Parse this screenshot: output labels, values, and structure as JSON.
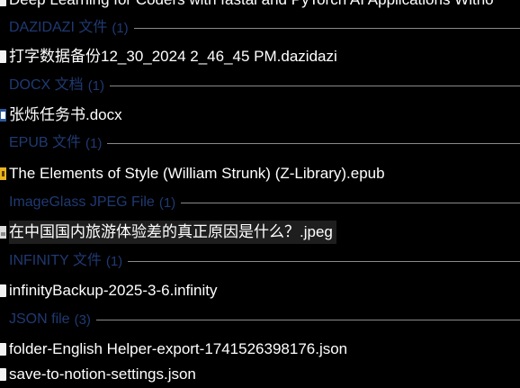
{
  "top_truncated_item": {
    "name": "Deep Learning for Coders with fastai and PyTorch AI Applications Witho",
    "icon": "file-icon"
  },
  "groups": [
    {
      "label": "DAZIDAZI 文件",
      "count": "(1)",
      "items": [
        {
          "name": "打字数据备份12_30_2024 2_46_45 PM.dazidazi",
          "icon": "file-icon"
        }
      ]
    },
    {
      "label": "DOCX 文档",
      "count": "(1)",
      "items": [
        {
          "name": "张烁任务书.docx",
          "icon": "word-document-icon"
        }
      ]
    },
    {
      "label": "EPUB 文件",
      "count": "(1)",
      "items": [
        {
          "name": "The Elements of Style (William Strunk) (Z-Library).epub",
          "icon": "epub-file-icon"
        }
      ]
    },
    {
      "label": "ImageGlass JPEG File",
      "count": "(1)",
      "items": [
        {
          "name": "在中国国内旅游体验差的真正原因是什么？.jpeg",
          "icon": "image-file-icon"
        }
      ]
    },
    {
      "label": "INFINITY 文件",
      "count": "(1)",
      "items": [
        {
          "name": "infinityBackup-2025-3-6.infinity",
          "icon": "file-icon"
        }
      ]
    },
    {
      "label": "JSON file",
      "count": "(3)",
      "items": [
        {
          "name": "folder-English Helper-export-1741526398176.json",
          "icon": "file-icon"
        },
        {
          "name": "save-to-notion-settings.json",
          "icon": "file-icon"
        }
      ]
    }
  ],
  "colors": {
    "background": "#000000",
    "group_label": "#1f3a73",
    "group_line": "#8a8a8a",
    "file_text": "#ffffff",
    "selected_highlight": "#1e1e1e"
  }
}
